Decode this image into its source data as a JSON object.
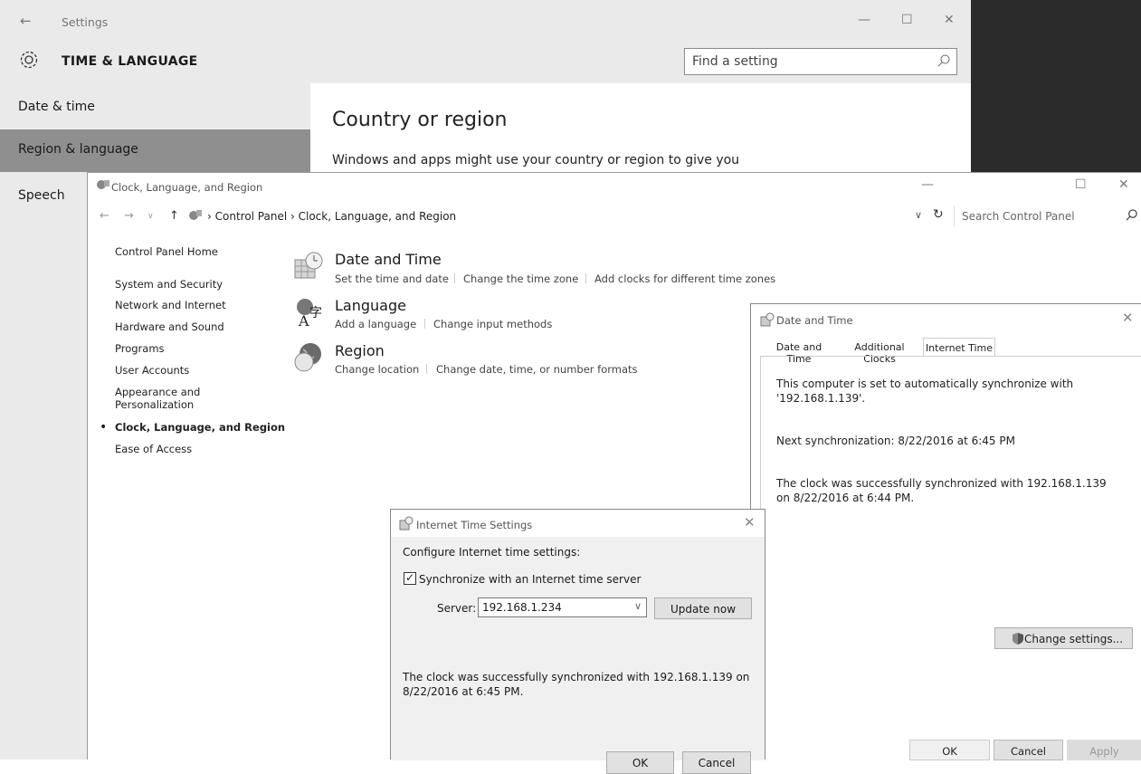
{
  "settings": {
    "back_glyph": "←",
    "title": "Settings",
    "heading": "TIME & LANGUAGE",
    "search_placeholder": "Find a setting",
    "nav": [
      "Date & time",
      "Region & language",
      "Speech"
    ],
    "region_heading": "Country or region",
    "region_desc": "Windows and apps might use your country or region to give you",
    "window_buttons": [
      "—",
      "☐",
      "✕"
    ]
  },
  "control_panel": {
    "title": "Clock, Language, and Region",
    "breadcrumb": "› Control Panel › Clock, Language, and Region",
    "search_placeholder": "Search Control Panel",
    "window_buttons": [
      "—",
      "☐",
      "✕"
    ],
    "nav_arrows": [
      "←",
      "→",
      "∨",
      "↑"
    ],
    "addr_dropdown": "∨",
    "refresh": "↻",
    "bullet": "•",
    "nav": [
      "Control Panel Home",
      "System and Security",
      "Network and Internet",
      "Hardware and Sound",
      "Programs",
      "User Accounts",
      "Appearance and Personalization",
      "Clock, Language, and Region",
      "Ease of Access"
    ],
    "categories": [
      {
        "title": "Date and Time",
        "links": [
          "Set the time and date",
          "Change the time zone",
          "Add clocks for different time zones"
        ]
      },
      {
        "title": "Language",
        "links": [
          "Add a language",
          "Change input methods"
        ]
      },
      {
        "title": "Region",
        "links": [
          "Change location",
          "Change date, time, or number formats"
        ]
      }
    ]
  },
  "date_time_dialog": {
    "title": "Date and Time",
    "close": "✕",
    "tabs": [
      "Date and Time",
      "Additional Clocks",
      "Internet Time"
    ],
    "active_tab": "Internet Time",
    "sync_text": "This computer is set to automatically synchronize with '192.168.1.139'.",
    "next_sync": "Next synchronization: 8/22/2016 at 6:45 PM",
    "last_sync": "The clock was successfully synchronized with 192.168.1.139 on 8/22/2016 at 6:44 PM.",
    "change_settings": "Change settings...",
    "ok": "OK",
    "cancel": "Cancel",
    "apply": "Apply"
  },
  "internet_time_dialog": {
    "title": "Internet Time Settings",
    "close": "✕",
    "configure": "Configure Internet time settings:",
    "checkbox_mark": "✓",
    "sync_label": "Synchronize with an Internet time server",
    "sync_checked": true,
    "server_label": "Server:",
    "server_value": "192.168.1.234",
    "server_dropdown": "∨",
    "update_now": "Update now",
    "message": "The clock was successfully synchronized with 192.168.1.139 on 8/22/2016 at 6:45 PM.",
    "ok": "OK",
    "cancel": "Cancel"
  }
}
